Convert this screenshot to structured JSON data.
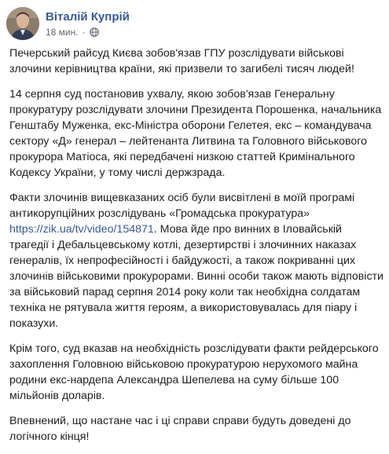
{
  "post": {
    "author": "Віталій Купрій",
    "time": "18 мин.",
    "dot": "·",
    "privacy_icon": "globe-icon",
    "paragraphs": [
      {
        "text": "Печерський райсуд Києва зобов'язав ГПУ розслідувати військові злочини керівництва країни, які призвели то загибелі тисяч людей!"
      },
      {
        "text": "14 серпня суд постановив ухвалу, якою зобов'язав Генеральну прокуратуру розслідувати злочини Президента Порошенка, начальника Генштабу Муженка, екс-Міністра оборони Гелетея, екс – командувача сектору «Д» генерал – лейтенанта Литвина та Головного військового прокурора Матіоса, які передбачені низкою статтей Кримінального Кодексу України, у тому числі держзрада."
      },
      {
        "before": "Факти злочинів вищевказаних осіб були висвітлені в моїй програмі антикорупційних розслідувань «Громадська прокуратура» ",
        "link": "https://zik.ua/tv/video/154871",
        "after": ". Мова йде про винних в Іловайській трагедії і Дебальцевському котлі, дезертирстві і злочинних наказах генералів, їх непрофесійності і байдужості, а також покриванні цих злочинів військовими прокурорами. Винні особи також мають відповісти за військовий парад серпня 2014 року коли так необхідна солдатам техніка не рятувала життя героям, а використовувалась для піару і показухи."
      },
      {
        "text": "Крім того, суд вказав на необхідність розслідувати факти рейдерського захоплення Головною військовою прокуратурою нерухомого майна родини екс-нардепа Александра Шепелева на суму більше 100 мільйонів доларів."
      },
      {
        "text": "Впевнений, що настане час і ці справи справи будуть доведені до логічного кінця!"
      }
    ]
  },
  "colors": {
    "author": "#385898",
    "link": "#385898",
    "text": "#1c1e21",
    "meta": "#616770"
  }
}
